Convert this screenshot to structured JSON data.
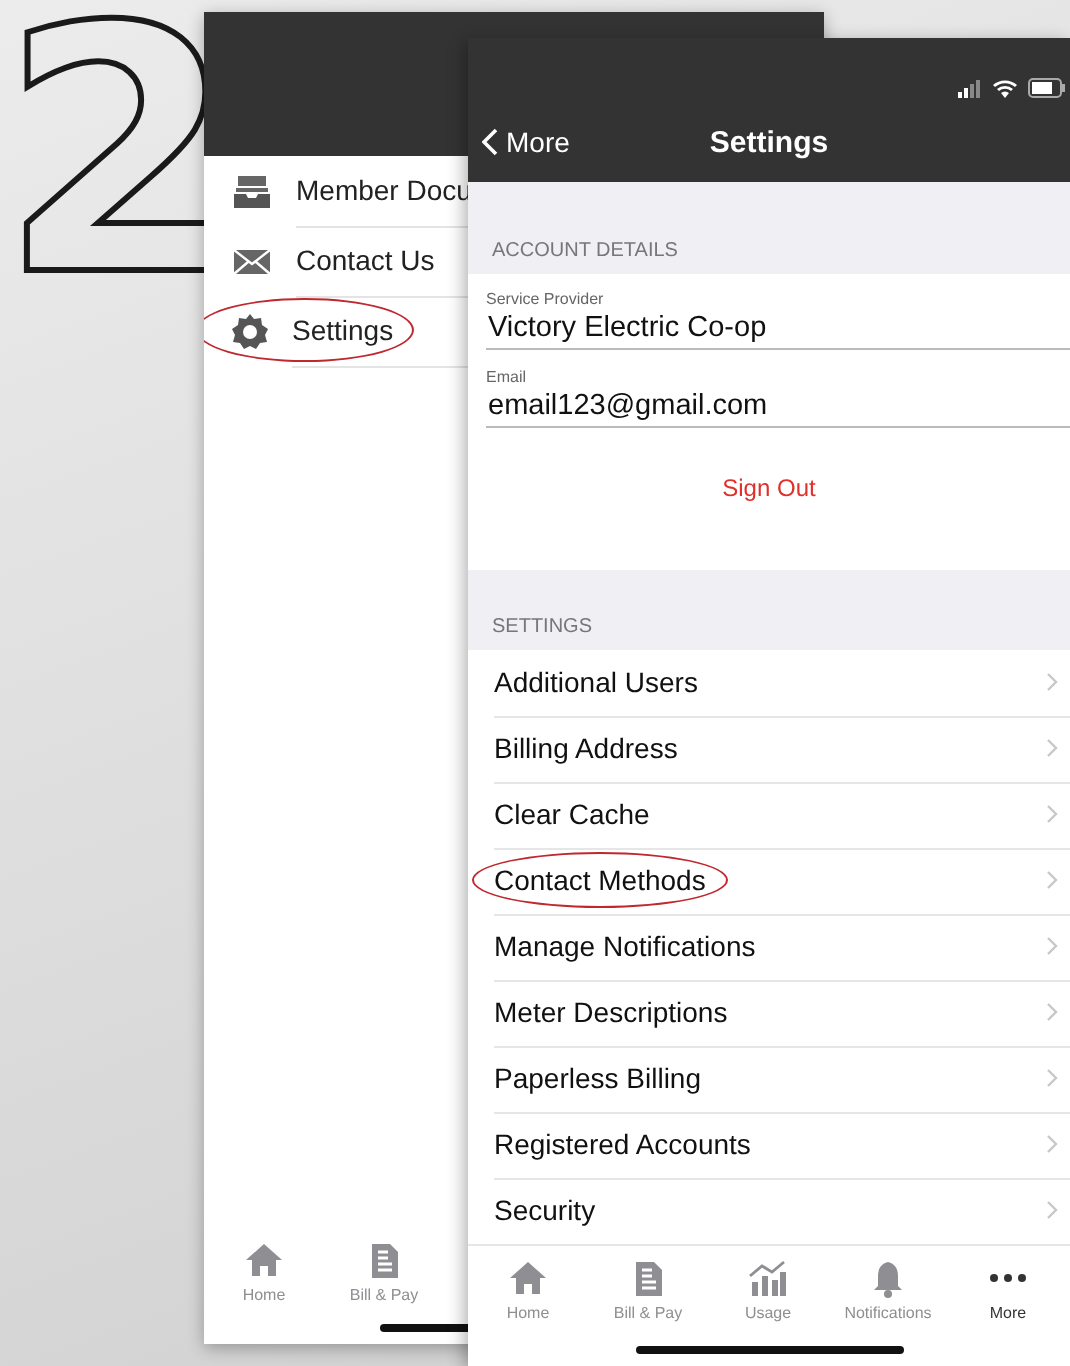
{
  "step_number": "2",
  "back_screen": {
    "menu_items": [
      {
        "kind": "documents",
        "label": "Member Docu",
        "circled": false
      },
      {
        "kind": "contact",
        "label": "Contact Us",
        "circled": false
      },
      {
        "kind": "settings",
        "label": "Settings",
        "circled": true
      }
    ],
    "tab_bar": [
      {
        "kind": "home",
        "label": "Home",
        "selected": false
      },
      {
        "kind": "bill",
        "label": "Bill & Pay",
        "selected": false
      }
    ]
  },
  "front_screen": {
    "nav": {
      "back_label": "More",
      "title": "Settings"
    },
    "account_details": {
      "header": "ACCOUNT DETAILS",
      "fields": [
        {
          "label": "Service Provider",
          "value": "Victory Electric Co-op"
        },
        {
          "label": "Email",
          "value": "email123@gmail.com"
        }
      ],
      "sign_out": "Sign Out"
    },
    "settings": {
      "header": "SETTINGS",
      "items": [
        {
          "label": "Additional Users",
          "circled": false
        },
        {
          "label": "Billing Address",
          "circled": false
        },
        {
          "label": "Clear Cache",
          "circled": false
        },
        {
          "label": "Contact Methods",
          "circled": true
        },
        {
          "label": "Manage Notifications",
          "circled": false
        },
        {
          "label": "Meter Descriptions",
          "circled": false
        },
        {
          "label": "Paperless Billing",
          "circled": false
        },
        {
          "label": "Registered Accounts",
          "circled": false
        },
        {
          "label": "Security",
          "circled": false
        }
      ]
    },
    "tab_bar": [
      {
        "kind": "home",
        "label": "Home",
        "selected": false
      },
      {
        "kind": "bill",
        "label": "Bill & Pay",
        "selected": false
      },
      {
        "kind": "usage",
        "label": "Usage",
        "selected": false
      },
      {
        "kind": "notifications",
        "label": "Notifications",
        "selected": false
      },
      {
        "kind": "more",
        "label": "More",
        "selected": true
      }
    ]
  }
}
